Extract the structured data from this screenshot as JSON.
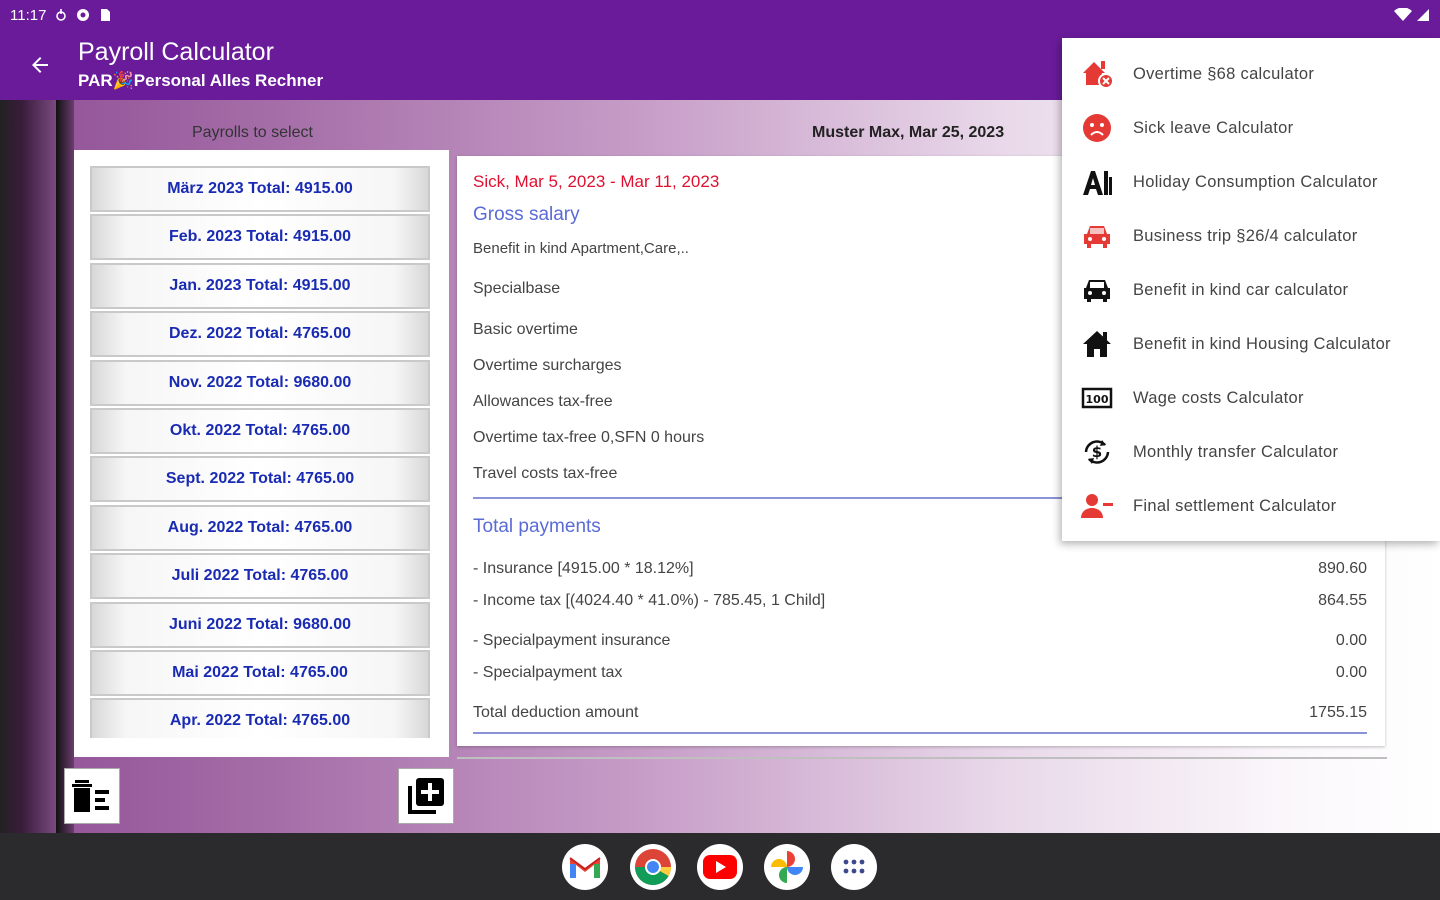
{
  "status_bar": {
    "time": "11:17"
  },
  "appbar": {
    "title": "Payroll Calculator",
    "subtitle": "PAR🎉Personal Alles Rechner"
  },
  "list_header": "Payrolls to select",
  "detail_header": "Muster Max, Mar 25, 2023",
  "payrolls": [
    "März 2023 Total: 4915.00",
    "Feb. 2023 Total: 4915.00",
    "Jan. 2023 Total: 4915.00",
    "Dez. 2022 Total: 4765.00",
    "Nov. 2022 Total: 9680.00",
    "Okt. 2022 Total: 4765.00",
    "Sept. 2022 Total: 4765.00",
    "Aug. 2022 Total: 4765.00",
    "Juli 2022 Total: 4765.00",
    "Juni 2022 Total: 9680.00",
    "Mai 2022 Total: 4765.00",
    "Apr. 2022 Total: 4765.00"
  ],
  "detail": {
    "sick_note": "Sick, Mar 5, 2023 - Mar 11, 2023",
    "gross_title": "Gross salary",
    "gross_rows": [
      "Benefit in kind Apartment,Care,..",
      "Specialbase",
      "Basic overtime",
      "Overtime surcharges",
      "Allowances tax-free",
      "Overtime tax-free 0,SFN 0 hours",
      "Travel costs tax-free"
    ],
    "payments_title": "Total payments",
    "deductions": [
      {
        "label": "- Insurance [4915.00 * 18.12%]",
        "value": "890.60"
      },
      {
        "label": "- Income tax [(4024.40 * 41.0%) - 785.45, 1 Child]",
        "value": "864.55"
      },
      {
        "label": "- Specialpayment insurance",
        "value": "0.00"
      },
      {
        "label": "- Specialpayment tax",
        "value": "0.00"
      }
    ],
    "total_label": "Total deduction amount",
    "total_value": "1755.15"
  },
  "menu": [
    {
      "label": "Overtime §68 calculator",
      "icon": "house-alert-icon",
      "color": "#e53935"
    },
    {
      "label": "Sick leave Calculator",
      "icon": "sick-face-icon",
      "color": "#e53935"
    },
    {
      "label": "Holiday Consumption Calculator",
      "icon": "ai-building-icon",
      "color": "#111111"
    },
    {
      "label": "Business trip §26/4 calculator",
      "icon": "car-front-icon",
      "color": "#e53935"
    },
    {
      "label": "Benefit in kind car calculator",
      "icon": "car-icon",
      "color": "#111111"
    },
    {
      "label": "Benefit in kind Housing Calculator",
      "icon": "home-icon",
      "color": "#111111"
    },
    {
      "label": "Wage costs Calculator",
      "icon": "money-icon",
      "color": "#111111"
    },
    {
      "label": "Monthly transfer Calculator",
      "icon": "dollar-cycle-icon",
      "color": "#111111"
    },
    {
      "label": "Final settlement Calculator",
      "icon": "person-remove-icon",
      "color": "#e53935"
    }
  ],
  "dock": [
    "gmail-icon",
    "chrome-icon",
    "youtube-icon",
    "photos-icon",
    "apps-icon"
  ]
}
